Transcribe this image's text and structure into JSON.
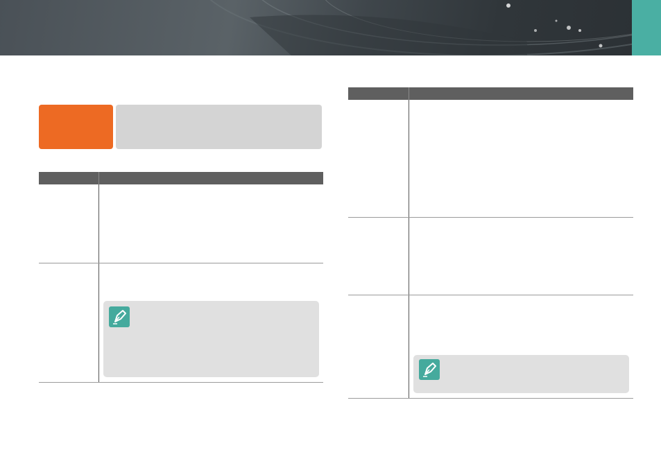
{
  "header": {
    "accent_color": "#4aafa3",
    "background_color": "#3f464b"
  },
  "intro": {
    "label_color": "#ed6a23",
    "panel_color": "#d4d4d4"
  },
  "left_table": {
    "rows": 2,
    "note_icon": "pen-note-icon"
  },
  "right_table": {
    "rows": 3,
    "note_icon": "pen-note-icon"
  }
}
